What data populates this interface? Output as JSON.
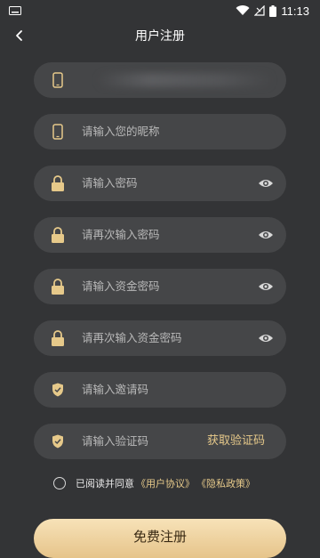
{
  "status": {
    "time": "11:13"
  },
  "title": "用户注册",
  "fields": [
    {
      "placeholder": "",
      "icon": "phone-icon"
    },
    {
      "placeholder": "请输入您的昵称",
      "icon": "phone-icon"
    },
    {
      "placeholder": "请输入密码",
      "icon": "lock-icon",
      "eye": true
    },
    {
      "placeholder": "请再次输入密码",
      "icon": "lock-icon",
      "eye": true
    },
    {
      "placeholder": "请输入资金密码",
      "icon": "lock-icon",
      "eye": true
    },
    {
      "placeholder": "请再次输入资金密码",
      "icon": "lock-icon",
      "eye": true
    },
    {
      "placeholder": "请输入邀请码",
      "icon": "shield-icon"
    },
    {
      "placeholder": "请输入验证码",
      "icon": "shield-icon"
    }
  ],
  "get_code_label": "获取验证码",
  "agreement": {
    "text": "已阅读并同意",
    "user_agreement": "《用户协议》",
    "privacy_policy": "《隐私政策》"
  },
  "submit_label": "免费注册",
  "colors": {
    "background": "#333436",
    "field": "#454648",
    "accent": "#e6c98a"
  }
}
